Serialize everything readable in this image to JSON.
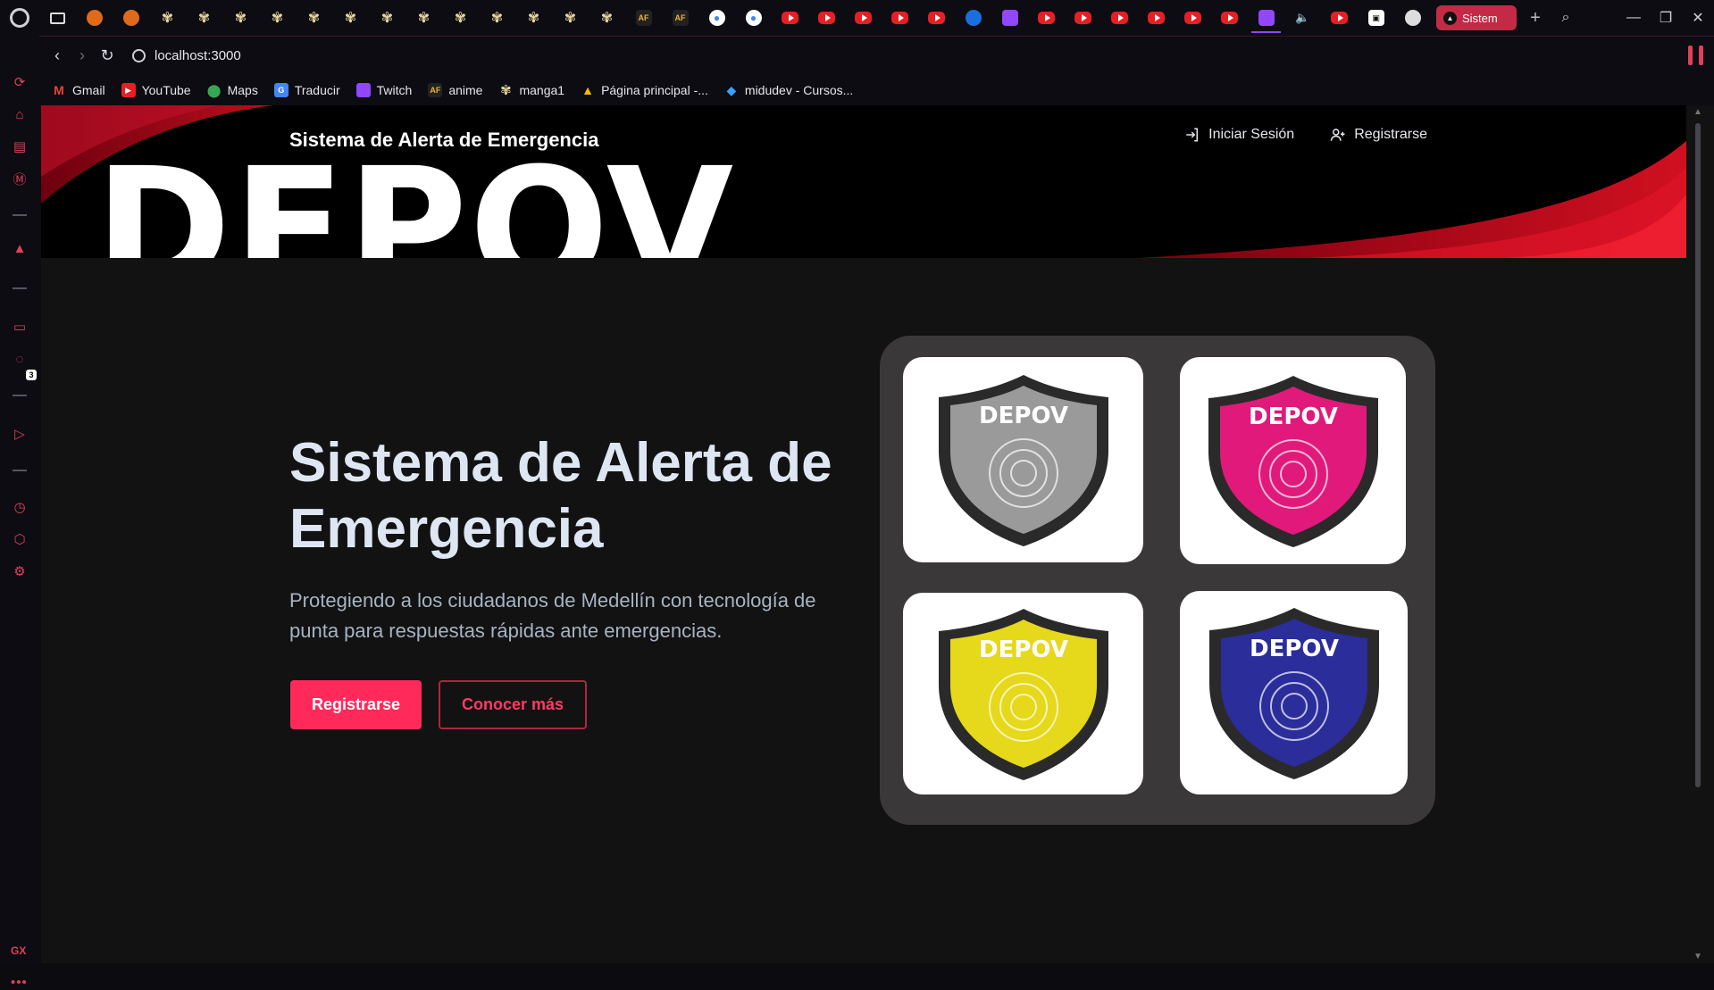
{
  "browser": {
    "active_tab_label": "Sistem",
    "url": "localhost:3000",
    "sidebar_badge": "3",
    "sidebar_gx": "GX",
    "tab_af_label": "AF"
  },
  "bookmarks": [
    {
      "label": "Gmail"
    },
    {
      "label": "YouTube"
    },
    {
      "label": "Maps"
    },
    {
      "label": "Traducir"
    },
    {
      "label": "Twitch"
    },
    {
      "label": "anime"
    },
    {
      "label": "manga1"
    },
    {
      "label": "Página principal -..."
    },
    {
      "label": "midudev - Cursos..."
    }
  ],
  "site": {
    "brand_subtitle": "Sistema de Alerta de Emergencia",
    "brand_logo": "DEPOV",
    "nav_login": "Iniciar Sesión",
    "nav_register": "Registrarse"
  },
  "hero": {
    "title": "Sistema de Alerta de Emergencia",
    "subtitle": "Protegiendo a los ciudadanos de Medellín con tecnología de punta para respuestas rápidas ante emergencias.",
    "primary_button": "Registrarse",
    "secondary_button": "Conocer más"
  },
  "logos": [
    {
      "text": "DEPOV",
      "color": "#9a9a9a"
    },
    {
      "text": "DEPOV",
      "color": "#e0197a"
    },
    {
      "text": "DEPOV",
      "color": "#e6d81a"
    },
    {
      "text": "DEPOV",
      "color": "#2a2d9a"
    }
  ],
  "colors": {
    "accent": "#ff2a5a",
    "header_bg": "#000000",
    "page_bg": "#121212"
  }
}
